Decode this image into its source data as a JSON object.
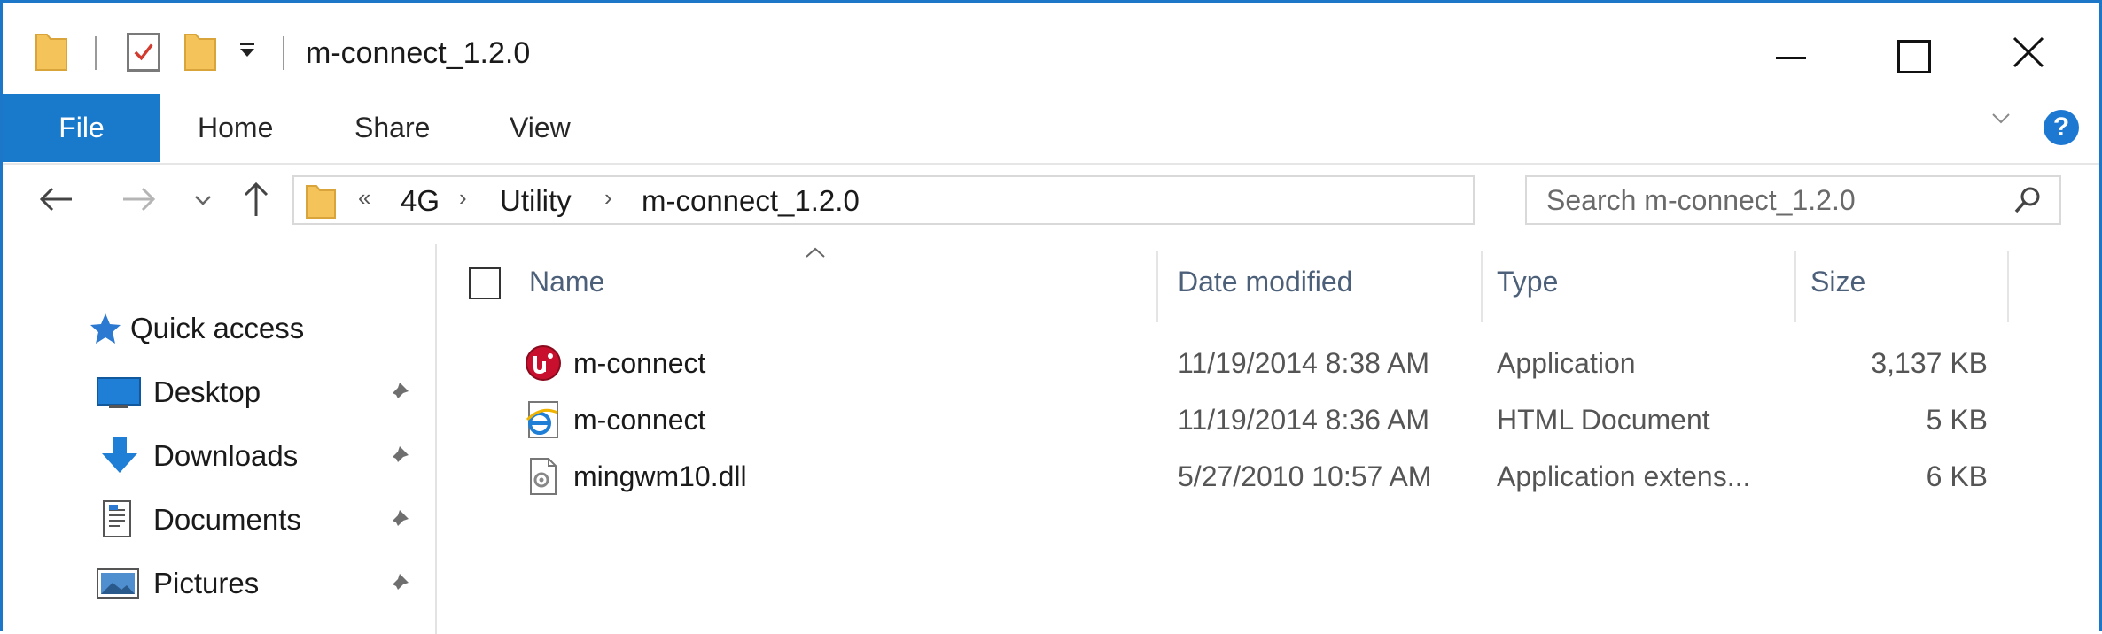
{
  "window": {
    "title": "m-connect_1.2.0",
    "close_glyph": "✕"
  },
  "ribbon": {
    "tabs": [
      {
        "label": "File",
        "active": true
      },
      {
        "label": "Home"
      },
      {
        "label": "Share"
      },
      {
        "label": "View"
      }
    ],
    "help_glyph": "?"
  },
  "address": {
    "overflow_glyph": "«",
    "separator_glyph": "›",
    "breadcrumbs": [
      "4G",
      "Utility",
      "m-connect_1.2.0"
    ]
  },
  "search": {
    "placeholder": "Search m-connect_1.2.0"
  },
  "navigation": {
    "items": [
      {
        "label": "Quick access",
        "icon": "star-icon"
      },
      {
        "label": "Desktop",
        "icon": "desktop-icon",
        "pinned": true
      },
      {
        "label": "Downloads",
        "icon": "download-arrow-icon",
        "pinned": true
      },
      {
        "label": "Documents",
        "icon": "documents-icon",
        "pinned": true
      },
      {
        "label": "Pictures",
        "icon": "pictures-icon",
        "pinned": true
      }
    ]
  },
  "filelist": {
    "columns": [
      "Name",
      "Date modified",
      "Type",
      "Size"
    ],
    "rows": [
      {
        "name": "m-connect",
        "icon": "application-icon",
        "date": "11/19/2014 8:38 AM",
        "type": "Application",
        "size": "3,137 KB"
      },
      {
        "name": "m-connect",
        "icon": "internet-explorer-icon",
        "date": "11/19/2014 8:36 AM",
        "type": "HTML Document",
        "size": "5 KB"
      },
      {
        "name": "mingwm10.dll",
        "icon": "dll-file-icon",
        "date": "5/27/2010 10:57 AM",
        "type": "Application extens...",
        "size": "6 KB"
      }
    ]
  },
  "colors": {
    "accent": "#1979ca",
    "folder": "#f4c45a",
    "app_icon_red": "#c8102e"
  }
}
